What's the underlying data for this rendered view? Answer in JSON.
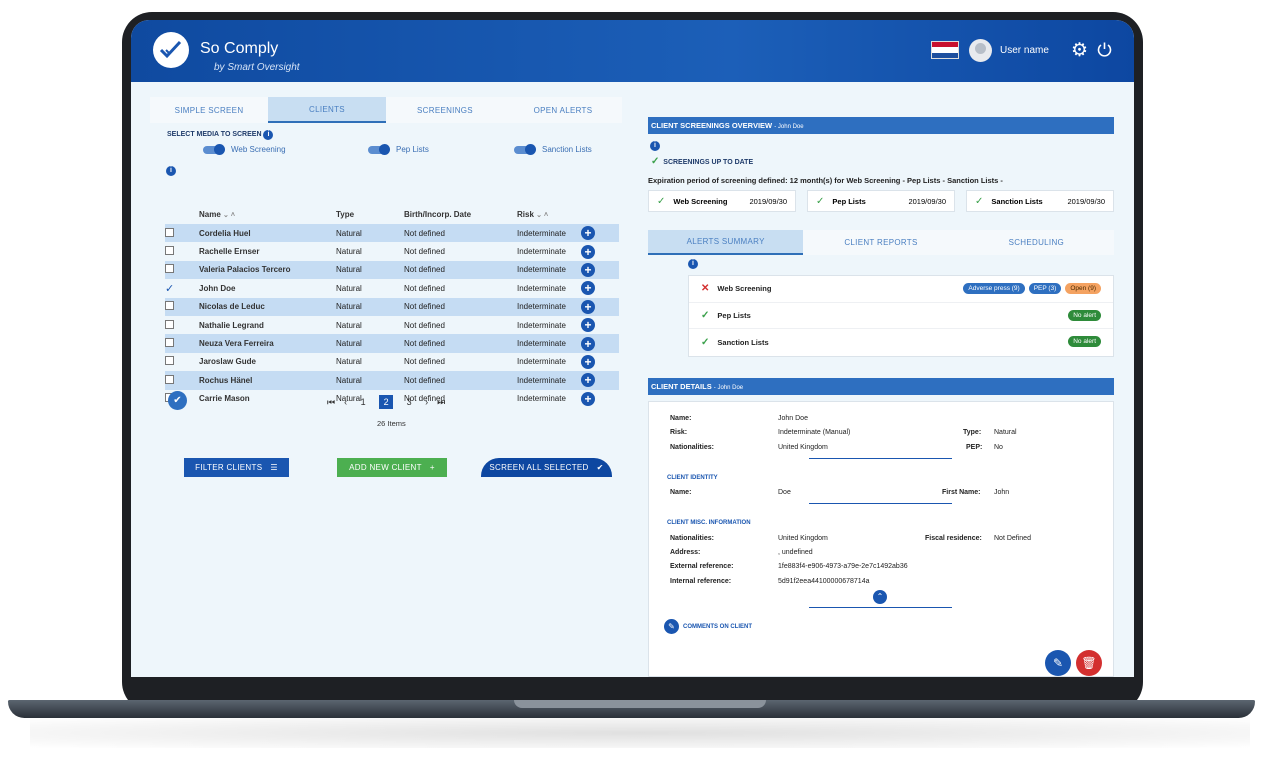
{
  "header": {
    "brand_so": "So",
    "brand_comply": "Comply",
    "tagline": "by Smart Oversight",
    "username": "User name",
    "flag_colors": [
      "#c8102e",
      "#ffffff",
      "#1e4f9e"
    ]
  },
  "left": {
    "tabs": [
      "SIMPLE SCREEN",
      "CLIENTS",
      "SCREENINGS",
      "OPEN ALERTS"
    ],
    "active_tab": "CLIENTS",
    "media_title": "SELECT MEDIA TO SCREEN",
    "toggles": [
      "Web Screening",
      "Pep Lists",
      "Sanction Lists"
    ],
    "columns": [
      "Name",
      "Type",
      "Birth/Incorp. Date",
      "Risk"
    ],
    "rows": [
      {
        "name": "Cordelia Huel",
        "type": "Natural",
        "date": "Not defined",
        "risk": "Indeterminate",
        "checked": false
      },
      {
        "name": "Rachelle Ernser",
        "type": "Natural",
        "date": "Not defined",
        "risk": "Indeterminate",
        "checked": false
      },
      {
        "name": "Valeria Palacios Tercero",
        "type": "Natural",
        "date": "Not defined",
        "risk": "Indeterminate",
        "checked": false
      },
      {
        "name": "John Doe",
        "type": "Natural",
        "date": "Not defined",
        "risk": "Indeterminate",
        "checked": true
      },
      {
        "name": "Nicolas de Leduc",
        "type": "Natural",
        "date": "Not defined",
        "risk": "Indeterminate",
        "checked": false
      },
      {
        "name": "Nathalie Legrand",
        "type": "Natural",
        "date": "Not defined",
        "risk": "Indeterminate",
        "checked": false
      },
      {
        "name": "Neuza Vera Ferreira",
        "type": "Natural",
        "date": "Not defined",
        "risk": "Indeterminate",
        "checked": false
      },
      {
        "name": "Jaroslaw Gude",
        "type": "Natural",
        "date": "Not defined",
        "risk": "Indeterminate",
        "checked": false
      },
      {
        "name": "Rochus Hänel",
        "type": "Natural",
        "date": "Not defined",
        "risk": "Indeterminate",
        "checked": false
      },
      {
        "name": "Carrie Mason",
        "type": "Natural",
        "date": "Not defined",
        "risk": "Indeterminate",
        "checked": false
      }
    ],
    "pages": [
      "1",
      "2",
      "3"
    ],
    "current_page": "2",
    "items_count": "26 Items",
    "buttons": {
      "filter": "FILTER CLIENTS",
      "add": "ADD NEW CLIENT",
      "screen": "SCREEN ALL SELECTED"
    }
  },
  "overview": {
    "title": "CLIENT SCREENINGS OVERVIEW",
    "client": "- John Doe",
    "status": "SCREENINGS UP TO DATE",
    "expiration": "Expiration period of screening defined: 12 month(s) for Web Screening - Pep Lists - Sanction Lists -",
    "screenings": [
      {
        "label": "Web Screening",
        "date": "2019/09/30"
      },
      {
        "label": "Pep Lists",
        "date": "2019/09/30"
      },
      {
        "label": "Sanction Lists",
        "date": "2019/09/30"
      }
    ]
  },
  "alerts": {
    "tabs": [
      "ALERTS SUMMARY",
      "CLIENT REPORTS",
      "SCHEDULING"
    ],
    "active_tab": "ALERTS SUMMARY",
    "rows": [
      {
        "label": "Web Screening",
        "status": "alert",
        "pills": [
          "Adverse press (9)",
          "PEP (3)",
          "Open (9)"
        ]
      },
      {
        "label": "Pep Lists",
        "status": "ok",
        "pills": [
          "No alert"
        ]
      },
      {
        "label": "Sanction Lists",
        "status": "ok",
        "pills": [
          "No alert"
        ]
      }
    ]
  },
  "details": {
    "title": "CLIENT DETAILS",
    "client": "- John Doe",
    "name_label": "Name:",
    "name": "John Doe",
    "risk_label": "Risk:",
    "risk": "Indeterminate (Manual)",
    "type_label": "Type:",
    "type": "Natural",
    "nat_label": "Nationalities:",
    "nationality": "United Kingdom",
    "pep_label": "PEP:",
    "pep": "No",
    "identity_title": "CLIENT IDENTITY",
    "id_name_label": "Name:",
    "id_name": "Doe",
    "first_name_label": "First Name:",
    "first_name": "John",
    "misc_title": "CLIENT MISC. INFORMATION",
    "misc_nat_label": "Nationalities:",
    "misc_nat": "United Kingdom",
    "fiscal_label": "Fiscal residence:",
    "fiscal": "Not Defined",
    "address_label": "Address:",
    "address": ", undefined",
    "ext_label": "External reference:",
    "ext_ref": "1fe883f4-e906-4973-a79e-2e7c1492ab36",
    "int_label": "Internal reference:",
    "int_ref": "5d91f2eea44100000678714a",
    "comments": "COMMENTS ON CLIENT"
  }
}
